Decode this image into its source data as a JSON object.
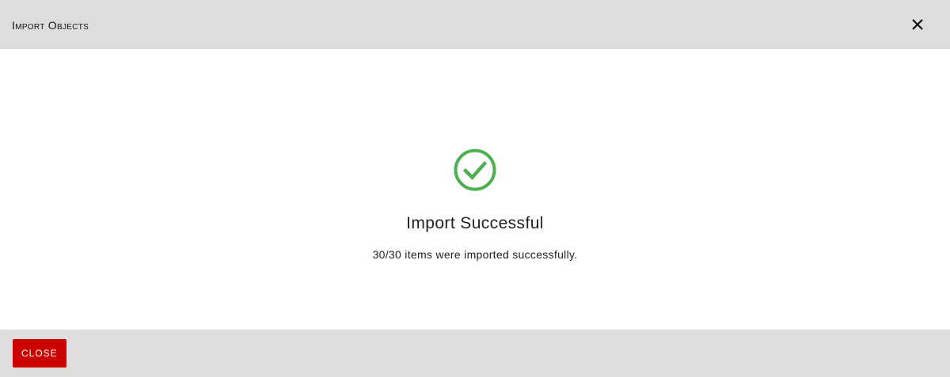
{
  "header": {
    "title": "Import Objects",
    "close_icon": "close-icon"
  },
  "result": {
    "icon": "check-circle-icon",
    "icon_color": "#4caf50",
    "title": "Import Successful",
    "message": "30/30 items were imported successfully."
  },
  "footer": {
    "close_label": "Close",
    "close_color": "#cc0000"
  }
}
